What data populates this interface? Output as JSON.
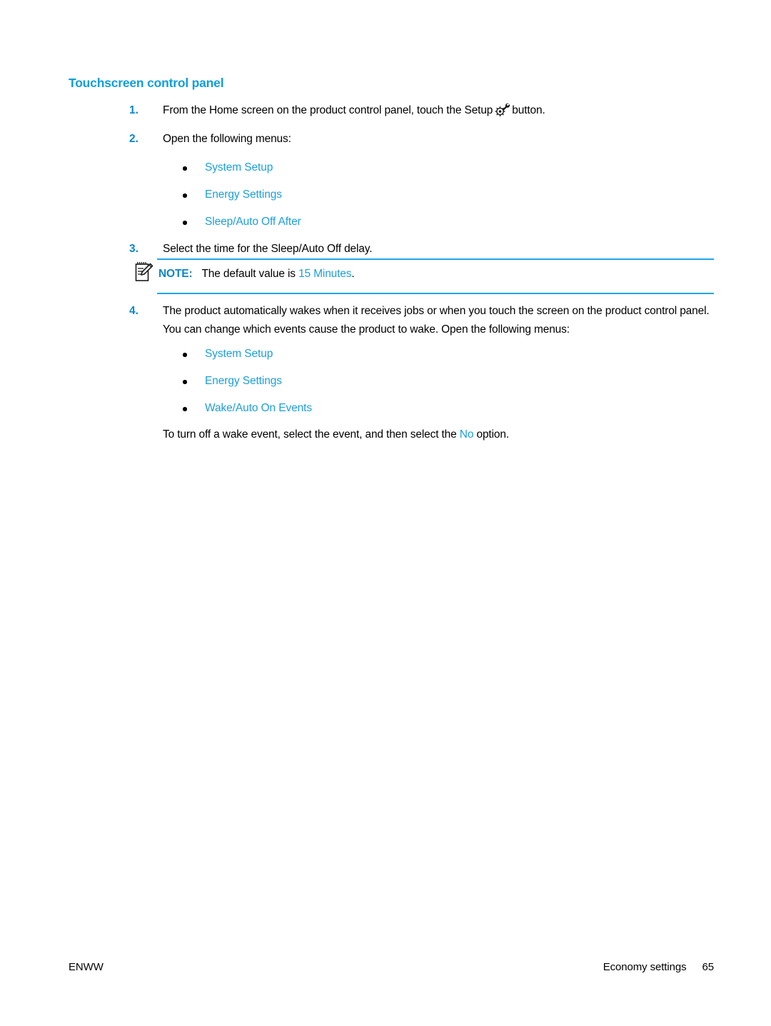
{
  "document": {
    "heading": "Touchscreen control panel",
    "accent_color": "#1b9fdb",
    "heading_color": "#0d9fdd",
    "number_color": "#0b86c9"
  },
  "steps": [
    {
      "number": "1.",
      "text_before_icon": "From the Home screen on the product control panel, touch the Setup",
      "icon": "setup-gear-wrench-icon",
      "text_after_icon": "button."
    },
    {
      "number": "2.",
      "text": "Open the following menus:"
    },
    {
      "number": "3.",
      "text": "Select the time for the Sleep/Auto Off delay."
    },
    {
      "number": "4.",
      "text": "The product automatically wakes when it receives jobs or when you touch the screen on the product control panel. You can change which events cause the product to wake. Open the following menus:"
    }
  ],
  "menu_list_1": [
    {
      "label": "System Setup"
    },
    {
      "label": "Energy Settings"
    },
    {
      "label": "Sleep/Auto Off After"
    }
  ],
  "menu_list_2": [
    {
      "label": "System Setup"
    },
    {
      "label": "Energy Settings"
    },
    {
      "label": "Wake/Auto On Events"
    }
  ],
  "note": {
    "icon": "note-pad-pencil-icon",
    "label": "NOTE:",
    "text_before_value": "The default value is",
    "value": "15 Minutes",
    "text_after_value": "."
  },
  "trailing_paragraph": {
    "text_before_value": "To turn off a wake event, select the event, and then select the",
    "value": "No",
    "text_after_value": "option."
  },
  "footer": {
    "left": "ENWW",
    "section": "Economy settings",
    "page_number": "65"
  }
}
